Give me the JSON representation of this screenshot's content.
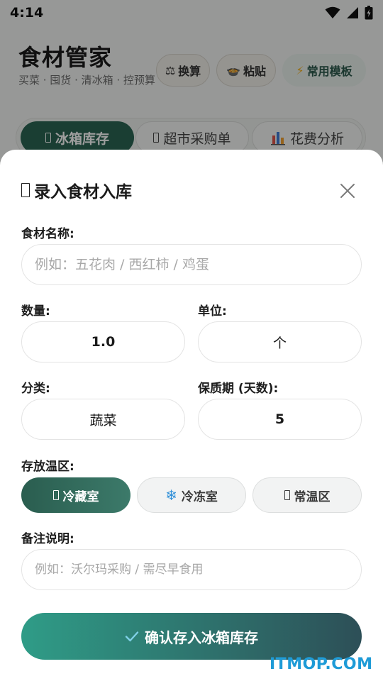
{
  "status_bar": {
    "time": "4:14"
  },
  "app": {
    "title": "食材管家",
    "subtitle": "买菜 · 囤货 · 清冰箱 · 控预算",
    "buttons": [
      {
        "icon": "scale-icon",
        "glyph": "⚖",
        "label": "换算"
      },
      {
        "icon": "bowl-icon",
        "glyph": "🍲",
        "label": "粘贴"
      },
      {
        "icon": "lightning-icon",
        "glyph": "⚡",
        "label": "常用模板"
      }
    ],
    "tabs": [
      {
        "label": "冰箱库存",
        "active": true
      },
      {
        "label": "超市采购单",
        "active": false
      },
      {
        "label": "花费分析",
        "icon": "bar-chart-icon",
        "active": false
      }
    ]
  },
  "sheet": {
    "title": "录入食材入库",
    "name_label": "食材名称:",
    "name_placeholder": "例如：五花肉 / 西红柿 / 鸡蛋",
    "qty_label": "数量:",
    "qty_value": "1.0",
    "unit_label": "单位:",
    "unit_value": "个",
    "category_label": "分类:",
    "category_value": "蔬菜",
    "shelf_label": "保质期 (天数):",
    "shelf_value": "5",
    "zone_label": "存放温区:",
    "zones": [
      {
        "label": "冷藏室",
        "selected": true
      },
      {
        "label": "冷冻室",
        "icon": "snowflake-icon",
        "glyph": "❄",
        "selected": false
      },
      {
        "label": "常温区",
        "selected": false
      }
    ],
    "note_label": "备注说明:",
    "note_placeholder": "例如：沃尔玛采购 / 需尽早食用",
    "confirm_label": "确认存入冰箱库存"
  },
  "colors": {
    "accent": "#2b6553",
    "confirm_start": "#2f9c87",
    "confirm_end": "#2d4f57",
    "watermark": "#1e9bd7"
  },
  "watermark": "ITMOP.COM"
}
